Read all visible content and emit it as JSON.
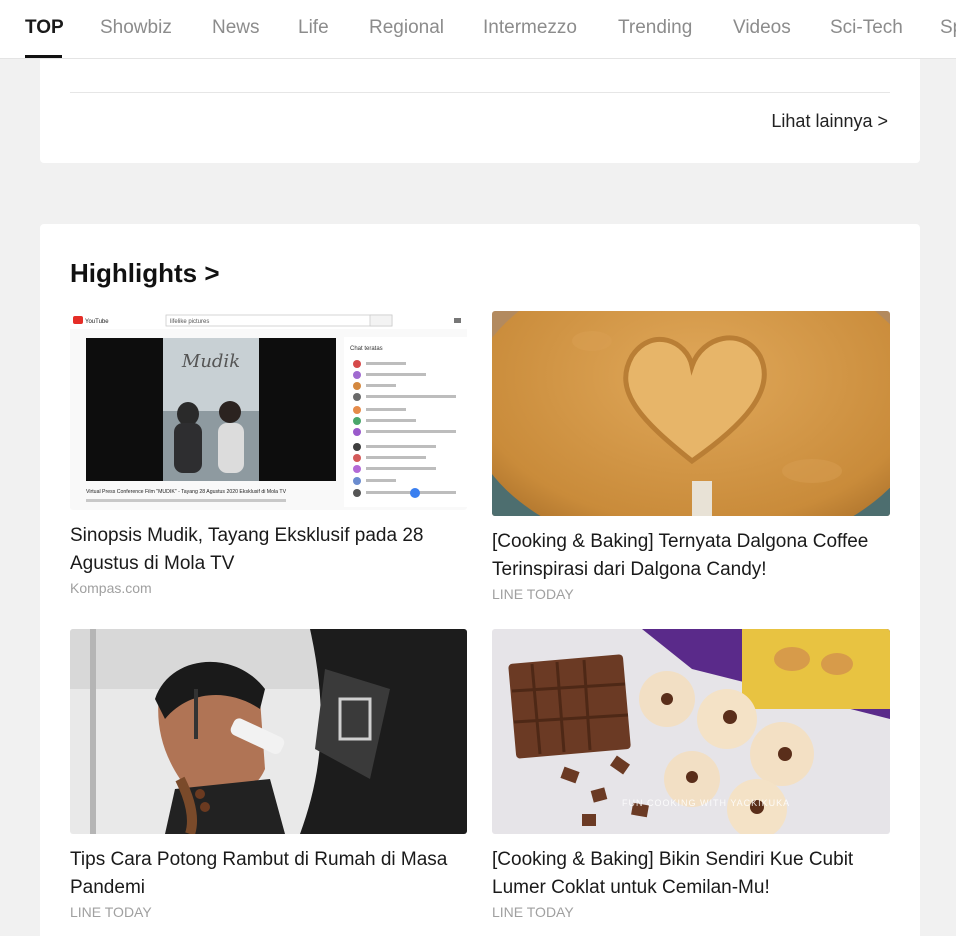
{
  "nav": {
    "tabs": [
      {
        "label": "TOP",
        "active": true
      },
      {
        "label": "Showbiz"
      },
      {
        "label": "News"
      },
      {
        "label": "Life"
      },
      {
        "label": "Regional"
      },
      {
        "label": "Intermezzo"
      },
      {
        "label": "Trending"
      },
      {
        "label": "Videos"
      },
      {
        "label": "Sci-Tech"
      },
      {
        "label": "Sp"
      }
    ]
  },
  "previous_section": {
    "more_label": "Lihat lainnya >"
  },
  "highlights": {
    "title": "Highlights >",
    "items": [
      {
        "title": "Sinopsis Mudik, Tayang Eksklusif pada 28 Agustus di Mola TV",
        "source": "Kompas.com",
        "thumb": {
          "search_text": "lifelike pictures",
          "poster_title": "Mudik",
          "chat_header": "Chat teratas",
          "caption": "Virtual Press Conference Film \"MUDIK\" - Tayang 28 Agustus 2020 Eksklusif di Mola TV"
        }
      },
      {
        "title": "[Cooking & Baking] Ternyata Dalgona Coffee Terinspirasi dari Dalgona Candy!",
        "source": "LINE TODAY"
      },
      {
        "title": "Tips Cara Potong Rambut di Rumah di Masa Pandemi",
        "source": "LINE TODAY"
      },
      {
        "title": "[Cooking & Baking] Bikin Sendiri Kue Cubit Lumer Coklat untuk Cemilan-Mu!",
        "source": "LINE TODAY",
        "thumb": {
          "watermark": "FUN COOKING WITH YACKIKUKA"
        }
      }
    ]
  },
  "colors": {
    "background": "#f1f1f1",
    "card": "#ffffff",
    "muted_text": "#a0a0a0",
    "nav_inactive": "#8c8c8c"
  }
}
